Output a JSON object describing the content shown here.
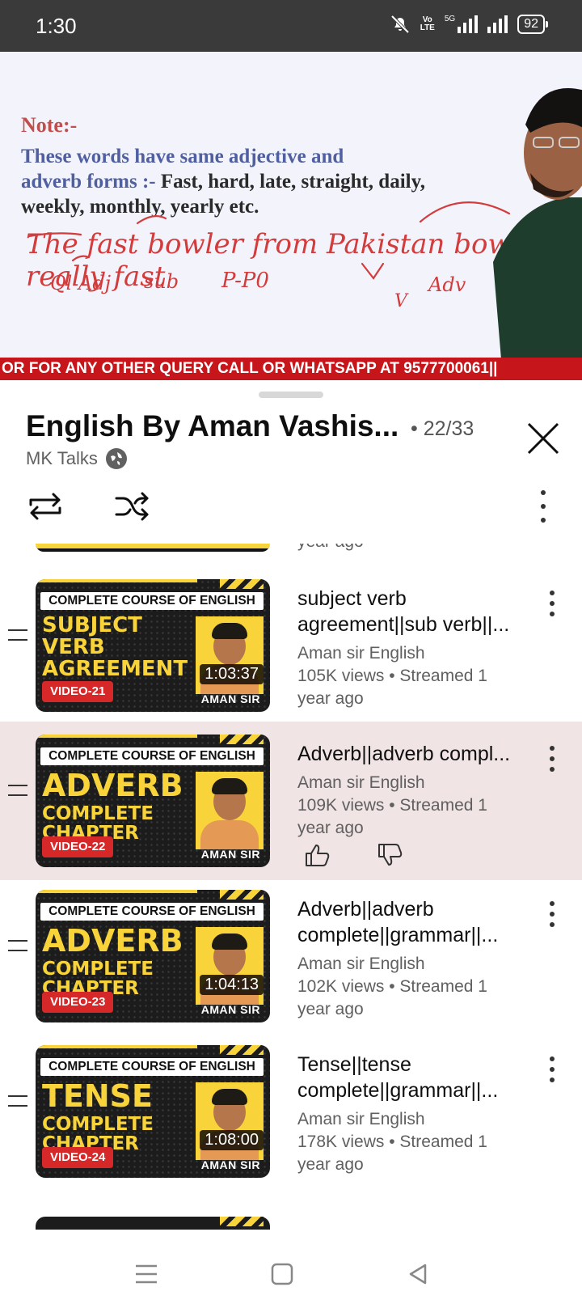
{
  "status_bar": {
    "time": "1:30",
    "network": "5G",
    "volte": "VoLTE",
    "battery": "92"
  },
  "video": {
    "note": "Note:-",
    "line1_blue": "These words have same adjective and",
    "line2_blue": "adverb forms :-",
    "line2_dark": " Fast, hard, late, straight, daily,",
    "line3_dark": "weekly, monthly, yearly etc.",
    "handwriting": "The fast bowler from Pakistan bowled really fast",
    "hand_labels": [
      "Ql Adj",
      "sub",
      "P-P0",
      "V",
      "Adv"
    ],
    "ticker": "OR FOR ANY OTHER QUERY CALL OR WHATSAPP AT 9577700061||"
  },
  "playlist": {
    "title": "English By Aman Vashis...",
    "count": "• 22/33",
    "channel": "MK Talks",
    "partial_top_meta": "year ago"
  },
  "items": [
    {
      "course_label": "COMPLETE COURSE OF ENGLISH",
      "big": "SUBJECT VERB AGREEMENT",
      "big_lines": [
        "SUBJECT",
        "VERB",
        "AGREEMENT"
      ],
      "sub_lines": [],
      "video_tag": "VIDEO-21",
      "duration": "1:03:37",
      "watermark": "AMAN SIR",
      "title": "subject verb agreement||sub verb||...",
      "channel": "Aman sir English",
      "views": "105K views • Streamed 1",
      "age": "year ago",
      "active": false
    },
    {
      "course_label": "COMPLETE COURSE OF ENGLISH",
      "big": "ADVERB",
      "big_lines": [
        "ADVERB"
      ],
      "sub_lines": [
        "COMPLETE",
        "CHAPTER"
      ],
      "video_tag": "VIDEO-22",
      "duration": "",
      "watermark": "AMAN SIR",
      "title": "Adverb||adverb compl...",
      "channel": "Aman sir English",
      "views": "109K views • Streamed 1",
      "age": "year ago",
      "active": true
    },
    {
      "course_label": "COMPLETE COURSE OF ENGLISH",
      "big": "ADVERB",
      "big_lines": [
        "ADVERB"
      ],
      "sub_lines": [
        "COMPLETE",
        "CHAPTER"
      ],
      "video_tag": "VIDEO-23",
      "duration": "1:04:13",
      "watermark": "AMAN SIR",
      "title": "Adverb||adverb complete||grammar||...",
      "channel": "Aman sir English",
      "views": "102K views • Streamed 1",
      "age": "year ago",
      "active": false
    },
    {
      "course_label": "COMPLETE COURSE OF ENGLISH",
      "big": "TENSE",
      "big_lines": [
        "TENSE"
      ],
      "sub_lines": [
        "COMPLETE",
        "CHAPTER"
      ],
      "video_tag": "VIDEO-24",
      "duration": "1:08:00",
      "watermark": "AMAN SIR",
      "title": "Tense||tense complete||grammar||...",
      "channel": "Aman sir English",
      "views": "178K views • Streamed 1",
      "age": "year ago",
      "active": false
    }
  ],
  "icons": {
    "close": "close-icon",
    "loop": "loop-icon",
    "shuffle": "shuffle-icon",
    "more": "more-vert-icon",
    "like": "thumb-up-icon",
    "dislike": "thumb-down-icon",
    "drag": "drag-handle-icon",
    "nav_menu": "nav-menu-icon",
    "nav_home": "nav-home-icon",
    "nav_back": "nav-back-icon"
  },
  "colors": {
    "ticker": "#c6161c",
    "accent_yellow": "#f8d33a",
    "active_row": "#f0e4e4",
    "tag_red": "#d62828"
  }
}
